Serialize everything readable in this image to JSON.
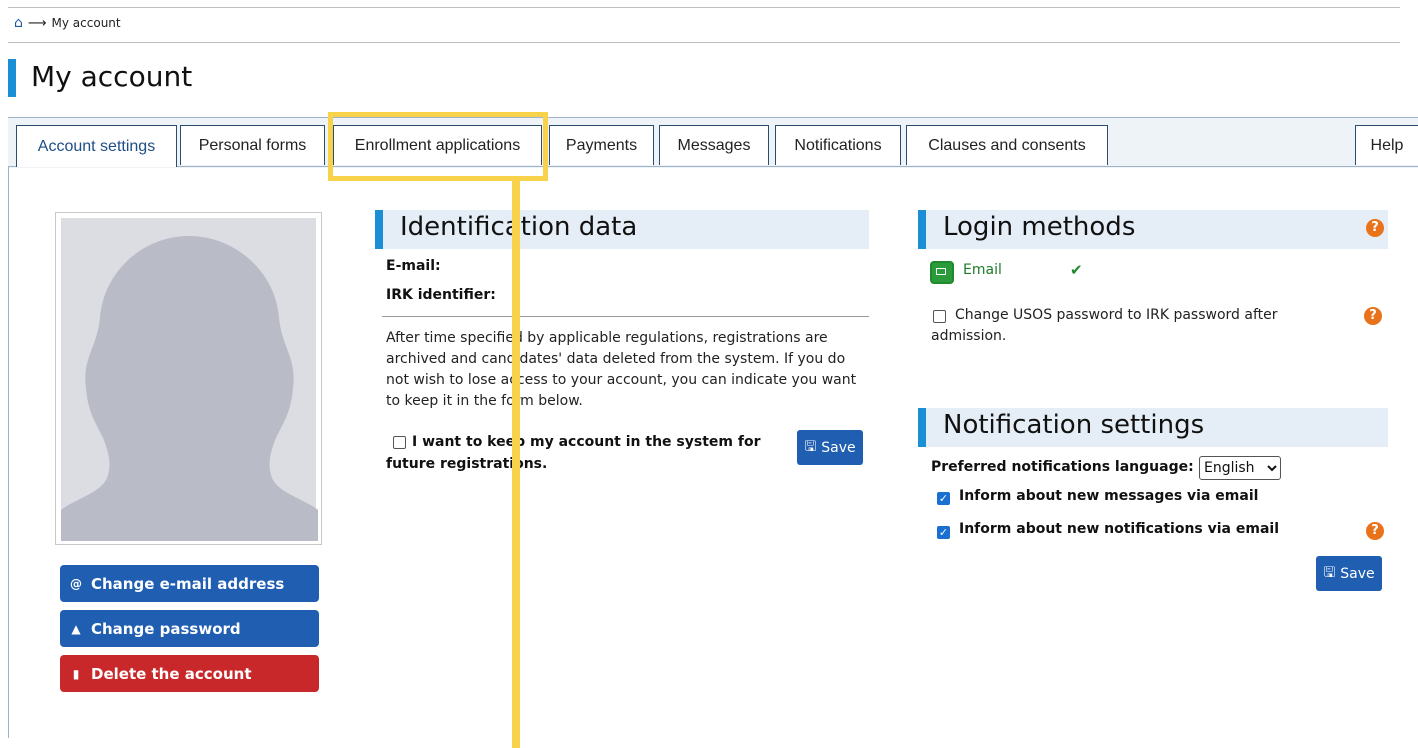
{
  "breadcrumb": {
    "current": "My account"
  },
  "page_title": "My account",
  "tabs": [
    {
      "label": "Account settings",
      "active": true
    },
    {
      "label": "Personal forms"
    },
    {
      "label": "Enrollment applications",
      "highlighted": true
    },
    {
      "label": "Payments"
    },
    {
      "label": "Messages"
    },
    {
      "label": "Notifications"
    },
    {
      "label": "Clauses and consents"
    },
    {
      "label": "Help"
    }
  ],
  "account_buttons": {
    "change_email": "Change e-mail address",
    "change_password": "Change password",
    "delete_account": "Delete the account"
  },
  "identification": {
    "title": "Identification data",
    "email_label": "E-mail:",
    "irk_label": "IRK identifier:",
    "info": "After time specified by applicable regulations, registrations are archived and candidates' data deleted from the system. If you do not wish to lose access to your account, you can indicate you want to keep it in the form below.",
    "keep_account_label": "I want to keep my account in the system for future registrations.",
    "keep_account_checked": false,
    "save_label": "Save"
  },
  "login_methods": {
    "title": "Login methods",
    "email_method": "Email",
    "email_enabled": true,
    "change_password_label": "Change USOS password to IRK password after admission.",
    "change_password_checked": false
  },
  "notification_settings": {
    "title": "Notification settings",
    "language_label": "Preferred notifications language:",
    "language_value": "English",
    "inform_messages_label": "Inform about new messages via email",
    "inform_messages_checked": true,
    "inform_notifications_label": "Inform about new notifications via email",
    "inform_notifications_checked": true,
    "save_label": "Save"
  },
  "colors": {
    "accent": "#1a8fd6",
    "button_blue": "#1f5eb1",
    "button_red": "#c8282a",
    "help_orange": "#e8731a",
    "highlight_yellow": "#f8d24a"
  }
}
